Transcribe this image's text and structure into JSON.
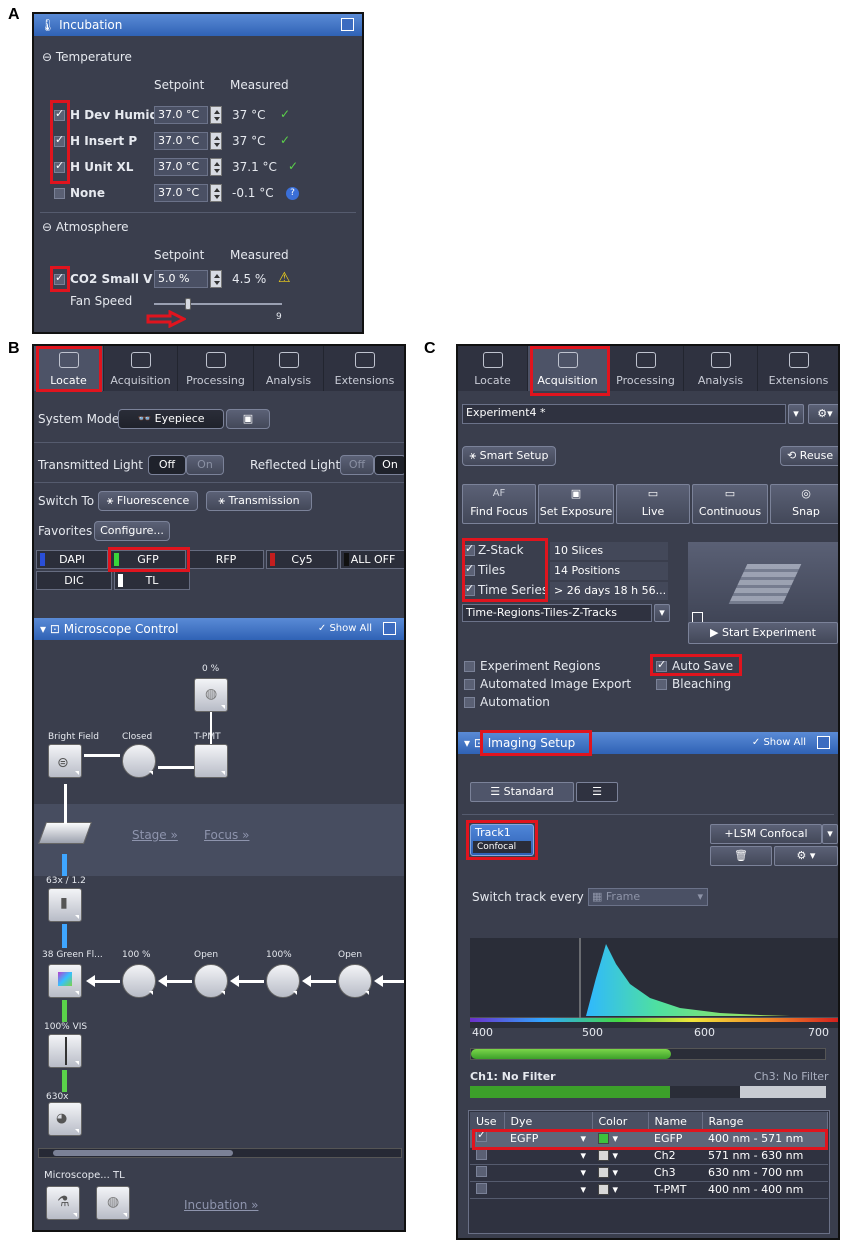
{
  "labels": {
    "a": "A",
    "b": "B",
    "c": "C"
  },
  "panelA": {
    "title": "Incubation",
    "temperature_section": "Temperature",
    "setpoint_header": "Setpoint",
    "measured_header": "Measured",
    "temp_rows": [
      {
        "name": "H Dev Humid",
        "checked": true,
        "setpoint": "37.0 °C",
        "measured": "37 °C",
        "status": "ok"
      },
      {
        "name": "H Insert P",
        "checked": true,
        "setpoint": "37.0 °C",
        "measured": "37 °C",
        "status": "ok"
      },
      {
        "name": "H Unit XL",
        "checked": true,
        "setpoint": "37.0 °C",
        "measured": "37.1 °C",
        "status": "ok"
      },
      {
        "name": "None",
        "checked": false,
        "setpoint": "37.0 °C",
        "measured": "-0.1 °C",
        "status": "info"
      }
    ],
    "atmosphere_section": "Atmosphere",
    "co2_row": {
      "name": "CO2 Small V",
      "checked": true,
      "setpoint": "5.0 %",
      "measured": "4.5 %",
      "status": "warning"
    },
    "fan_speed_label": "Fan Speed",
    "fan_speed_max": "9",
    "fan_speed_level": 0.25
  },
  "panelB": {
    "tabs": [
      "Locate",
      "Acquisition",
      "Processing",
      "Analysis",
      "Extensions"
    ],
    "active_tab": "Locate",
    "system_mode_label": "System Mode",
    "eyepiece_label": "Eyepiece",
    "transmitted_light_label": "Transmitted Light",
    "transmitted_off": "Off",
    "transmitted_on": "On",
    "reflected_light_label": "Reflected Light",
    "reflected_off": "Off",
    "reflected_on": "On",
    "switch_to_label": "Switch To",
    "fluorescence_label": "Fluorescence",
    "transmission_label": "Transmission",
    "favorites_label": "Favorites",
    "configure_label": "Configure...",
    "favorites": [
      {
        "label": "DAPI",
        "color": "#2a4fd8"
      },
      {
        "label": "GFP",
        "color": "#3ad43a"
      },
      {
        "label": "RFP",
        "color": ""
      },
      {
        "label": "Cy5",
        "color": "#c41e1e"
      },
      {
        "label": "ALL OFF",
        "color": "#111111"
      },
      {
        "label": "DIC",
        "color": ""
      },
      {
        "label": "TL",
        "color": "#ffffff"
      }
    ],
    "mc_title": "Microscope Control",
    "show_all": "Show All",
    "lamp_percent": "0 %",
    "bright_field": "Bright Field",
    "closed": "Closed",
    "tpmt": "T-PMT",
    "stage_link": "Stage »",
    "focus_link": "Focus »",
    "objective": "63x / 1.2",
    "filter_label": "38 Green Fl...",
    "percent_100a": "100 %",
    "open_a": "Open",
    "percent_100b": "100%",
    "open_b": "Open",
    "vis_label": "100% VIS",
    "camera_label": "630x",
    "microscope_tl": "Microscope... TL",
    "incubation_link": "Incubation »"
  },
  "panelC": {
    "tabs": [
      "Locate",
      "Acquisition",
      "Processing",
      "Analysis",
      "Extensions"
    ],
    "active_tab": "Acquisition",
    "experiment_name": "Experiment4 *",
    "smart_setup": "Smart Setup",
    "reuse": "Reuse",
    "tools": [
      {
        "icon": "AF",
        "label": "Find Focus"
      },
      {
        "icon": "camera",
        "label": "Set Exposure"
      },
      {
        "icon": "live",
        "label": "Live"
      },
      {
        "icon": "continuous",
        "label": "Continuous"
      },
      {
        "icon": "snap",
        "label": "Snap"
      }
    ],
    "dimensions": [
      {
        "label": "Z-Stack",
        "value": "10 Slices"
      },
      {
        "label": "Tiles",
        "value": "14 Positions"
      },
      {
        "label": "Time Series",
        "value": "> 26 days 18 h 56..."
      }
    ],
    "template": "Time-Regions-Tiles-Z-Tracks",
    "start_experiment": "Start Experiment",
    "options_left": [
      "Experiment Regions",
      "Automated Image Export",
      "Automation"
    ],
    "auto_save": "Auto Save",
    "bleaching": "Bleaching",
    "imaging_title": "Imaging Setup",
    "show_all": "Show All",
    "standard": "Standard",
    "track_name": "Track1",
    "track_sub": "Confocal",
    "lsm_confocal": "+LSM Confocal",
    "switch_track": "Switch track every",
    "switch_value": "Frame",
    "spectrum_ticks": [
      "400",
      "500",
      "600",
      "700"
    ],
    "ch1_filter": "Ch1: No Filter",
    "ch3_filter": "Ch3: No Filter",
    "table_headers": [
      "Use",
      "Dye",
      "Color",
      "Name",
      "Range"
    ],
    "channels": [
      {
        "use": true,
        "dye": "EGFP",
        "color": "#3cc23c",
        "name": "EGFP",
        "range": "400 nm - 571 nm"
      },
      {
        "use": false,
        "dye": "",
        "color": "#d8d8d8",
        "name": "Ch2",
        "range": "571 nm - 630 nm"
      },
      {
        "use": false,
        "dye": "",
        "color": "#d8d8d8",
        "name": "Ch3",
        "range": "630 nm - 700 nm"
      },
      {
        "use": false,
        "dye": "",
        "color": "#d8d8d8",
        "name": "T-PMT",
        "range": "400 nm - 400 nm"
      }
    ]
  }
}
